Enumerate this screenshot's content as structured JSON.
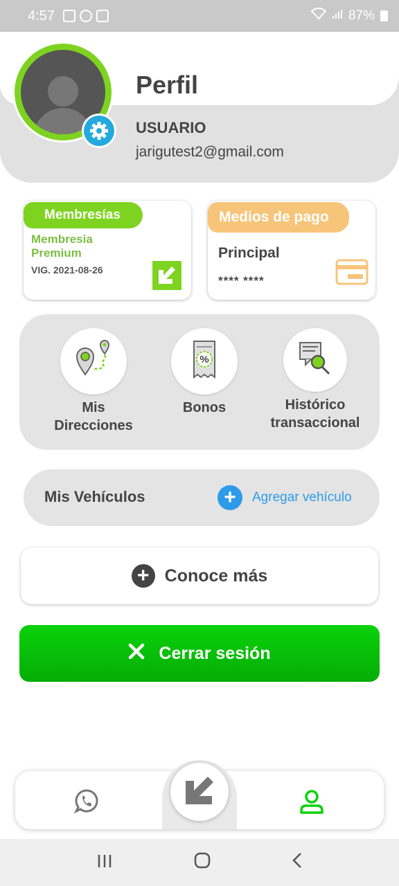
{
  "status_bar": {
    "time": "4:57",
    "battery": "87%"
  },
  "header": {
    "title": "Perfil",
    "username": "USUARIO",
    "email": "jarigutest2@gmail.com"
  },
  "membership_card": {
    "tag": "Membresías",
    "name": "Membresia Premium",
    "validity": "VIG. 2021-08-26"
  },
  "payment_card": {
    "tag": "Medios de pago",
    "label": "Principal",
    "number": "**** ****"
  },
  "quick_links": [
    {
      "label": "Mis Direcciones",
      "icon": "map-pin-route-icon"
    },
    {
      "label": "Bonos",
      "icon": "discount-ticket-icon"
    },
    {
      "label": "Histórico transaccional",
      "icon": "document-search-icon"
    }
  ],
  "vehicles": {
    "title": "Mis Vehículos",
    "add_label": "Agregar vehículo"
  },
  "learn_more": {
    "label": "Conoce más"
  },
  "logout": {
    "label": "Cerrar sesión"
  },
  "colors": {
    "green": "#7ed321",
    "bright_green": "#0ad20a",
    "blue": "#2d9bea",
    "orange": "#f6c57a",
    "gear_blue": "#24a9dd"
  }
}
